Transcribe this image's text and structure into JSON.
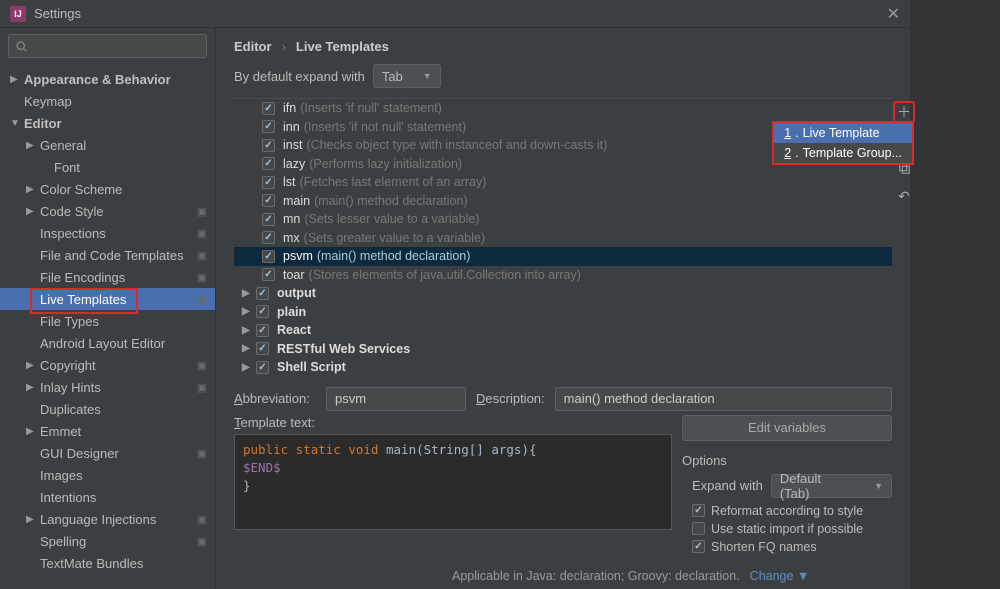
{
  "titlebar": {
    "title": "Settings"
  },
  "search": {
    "placeholder": ""
  },
  "sidebar": [
    {
      "label": "Appearance & Behavior",
      "depth": 0,
      "arrow": "▶",
      "bold": true
    },
    {
      "label": "Keymap",
      "depth": 0,
      "arrow": ""
    },
    {
      "label": "Editor",
      "depth": 0,
      "arrow": "▼",
      "bold": true
    },
    {
      "label": "General",
      "depth": 1,
      "arrow": "▶"
    },
    {
      "label": "Font",
      "depth": 2,
      "arrow": ""
    },
    {
      "label": "Color Scheme",
      "depth": 1,
      "arrow": "▶"
    },
    {
      "label": "Code Style",
      "depth": 1,
      "arrow": "▶",
      "mod": "■"
    },
    {
      "label": "Inspections",
      "depth": 1,
      "arrow": "",
      "mod": "■"
    },
    {
      "label": "File and Code Templates",
      "depth": 1,
      "arrow": "",
      "mod": "■"
    },
    {
      "label": "File Encodings",
      "depth": 1,
      "arrow": "",
      "mod": "■"
    },
    {
      "label": "Live Templates",
      "depth": 1,
      "arrow": "",
      "mod": "■",
      "selected": true,
      "red": true
    },
    {
      "label": "File Types",
      "depth": 1,
      "arrow": ""
    },
    {
      "label": "Android Layout Editor",
      "depth": 1,
      "arrow": ""
    },
    {
      "label": "Copyright",
      "depth": 1,
      "arrow": "▶",
      "mod": "■"
    },
    {
      "label": "Inlay Hints",
      "depth": 1,
      "arrow": "▶",
      "mod": "■"
    },
    {
      "label": "Duplicates",
      "depth": 1,
      "arrow": ""
    },
    {
      "label": "Emmet",
      "depth": 1,
      "arrow": "▶"
    },
    {
      "label": "GUI Designer",
      "depth": 1,
      "arrow": "",
      "mod": "■"
    },
    {
      "label": "Images",
      "depth": 1,
      "arrow": ""
    },
    {
      "label": "Intentions",
      "depth": 1,
      "arrow": ""
    },
    {
      "label": "Language Injections",
      "depth": 1,
      "arrow": "▶",
      "mod": "■"
    },
    {
      "label": "Spelling",
      "depth": 1,
      "arrow": "",
      "mod": "■"
    },
    {
      "label": "TextMate Bundles",
      "depth": 1,
      "arrow": ""
    }
  ],
  "breadcrumb": {
    "a": "Editor",
    "sep": "›",
    "b": "Live Templates"
  },
  "default_expand": {
    "label": "By default expand with",
    "value": "Tab"
  },
  "templates": [
    {
      "abbr": "ifn",
      "desc": "(Inserts 'if null' statement)",
      "group": false
    },
    {
      "abbr": "inn",
      "desc": "(Inserts 'if not null' statement)",
      "group": false
    },
    {
      "abbr": "inst",
      "desc": "(Checks object type with instanceof and down-casts it)",
      "group": false
    },
    {
      "abbr": "lazy",
      "desc": "(Performs lazy initialization)",
      "group": false
    },
    {
      "abbr": "lst",
      "desc": "(Fetches last element of an array)",
      "group": false
    },
    {
      "abbr": "main",
      "desc": "(main() method declaration)",
      "group": false
    },
    {
      "abbr": "mn",
      "desc": "(Sets lesser value to a variable)",
      "group": false
    },
    {
      "abbr": "mx",
      "desc": "(Sets greater value to a variable)",
      "group": false
    },
    {
      "abbr": "psvm",
      "desc": "(main() method declaration)",
      "group": false,
      "sel": true
    },
    {
      "abbr": "toar",
      "desc": "(Stores elements of java.util.Collection into array)",
      "group": false
    },
    {
      "abbr": "output",
      "group": true
    },
    {
      "abbr": "plain",
      "group": true
    },
    {
      "abbr": "React",
      "group": true
    },
    {
      "abbr": "RESTful Web Services",
      "group": true
    },
    {
      "abbr": "Shell Script",
      "group": true
    }
  ],
  "popup": {
    "item1": "Live Template",
    "item2": "Template Group..."
  },
  "form": {
    "abbr_label": "Abbreviation:",
    "abbr_value": "psvm",
    "desc_label": "Description:",
    "desc_value": "main() method declaration",
    "tt_label": "Template text:",
    "editvars": "Edit variables"
  },
  "editor": {
    "l1a": "public static void",
    "l1b": " main(String[] args){",
    "l2a": "  ",
    "l2b": "$END$",
    "l3": "}"
  },
  "options": {
    "hdr": "Options",
    "expand_label": "Expand with",
    "expand_value": "Default (Tab)",
    "o1": "Reformat according to style",
    "o2": "Use static import if possible",
    "o3": "Shorten FQ names"
  },
  "footer": {
    "text": "Applicable in Java: declaration; Groovy: declaration.",
    "link": "Change"
  }
}
